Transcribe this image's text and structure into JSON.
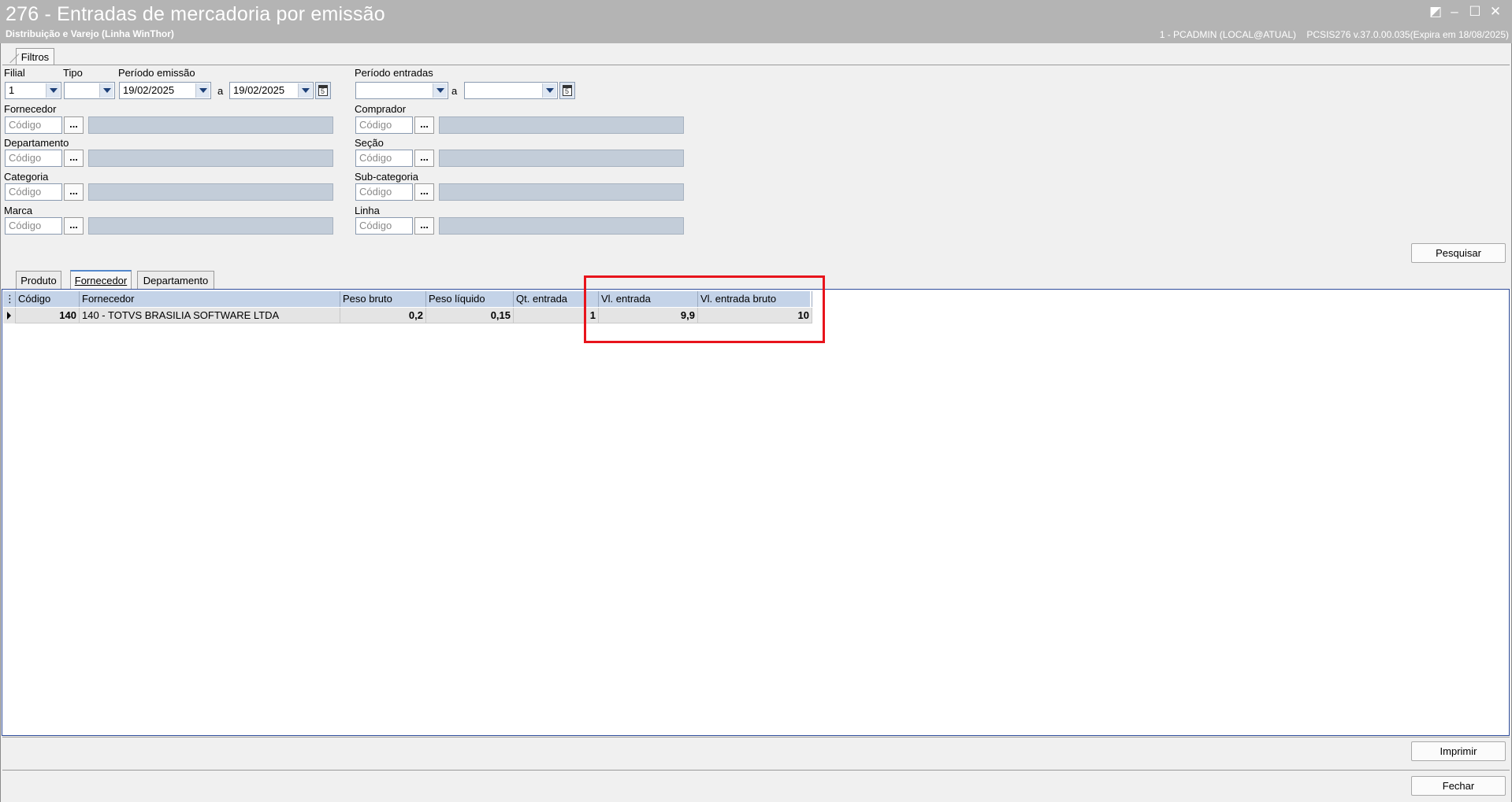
{
  "window": {
    "title": "276 - Entradas de mercadoria por emissão",
    "subtitle": "Distribuição e Varejo (Linha WinThor)",
    "user_info": "1 - PCADMIN (LOCAL@ATUAL)",
    "version_info": "PCSIS276  v.37.0.00.035(Expira em 18/08/2025)",
    "controls": {
      "restore": "◩",
      "minimize": "–",
      "maximize": "☐",
      "close": "✕"
    }
  },
  "filters_tab": {
    "label": "Filtros"
  },
  "filters": {
    "filial_label": "Filial",
    "filial_value": "1",
    "tipo_label": "Tipo",
    "tipo_value": "",
    "periodo_emissao_label": "Período emissão",
    "emissao_from": "19/02/2025",
    "emissao_to": "19/02/2025",
    "a_label": "a",
    "periodo_entradas_label": "Período entradas",
    "entradas_from": "",
    "entradas_to": "",
    "fornecedor_label": "Fornecedor",
    "comprador_label": "Comprador",
    "departamento_label": "Departamento",
    "secao_label": "Seção",
    "categoria_label": "Categoria",
    "subcategoria_label": "Sub-categoria",
    "marca_label": "Marca",
    "linha_label": "Linha",
    "codigo_placeholder": "Código",
    "dots": "..."
  },
  "buttons": {
    "pesquisar": "Pesquisar",
    "imprimir": "Imprimir",
    "fechar": "Fechar"
  },
  "result_tabs": [
    {
      "label": "Produto",
      "active": false
    },
    {
      "label": "Fornecedor",
      "active": true
    },
    {
      "label": "Departamento",
      "active": false
    }
  ],
  "grid": {
    "columns": [
      "Código",
      "Fornecedor",
      "Peso bruto",
      "Peso líquido",
      "Qt. entrada",
      "Vl. entrada",
      "Vl. entrada bruto"
    ],
    "rows": [
      [
        "140",
        "140 - TOTVS BRASILIA SOFTWARE LTDA",
        "0,2",
        "0,15",
        "1",
        "9,9",
        "10"
      ]
    ]
  },
  "colors": {
    "titlebar": "#b4b4b4",
    "grid_header": "#c4d3e8",
    "highlight": "#e8141c",
    "grid_border": "#2f4d9c"
  }
}
